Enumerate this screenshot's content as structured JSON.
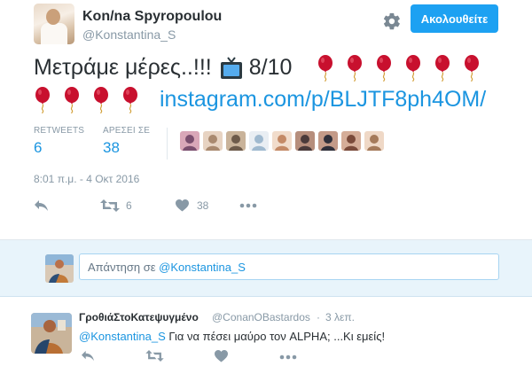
{
  "author": {
    "name": "Kon/na Spyropoulou",
    "handle": "@Konstantina_S",
    "avatar_icon": "profile-photo"
  },
  "follow_button": {
    "label": "Ακολουθείτε"
  },
  "settings_icon": "gear-icon",
  "tweet": {
    "text_main": "Μετράμε μέρες..!!!",
    "counter": "8/10",
    "balloon_count_line1": 6,
    "balloon_count_line2": 4,
    "link": "instagram.com/p/BLJTF8ph4OM/",
    "emoji_icons": [
      "tv-icon",
      "balloon-icon"
    ]
  },
  "stats": {
    "retweets_label": "RETWEETS",
    "retweets_value": "6",
    "likes_label": "ΑΡΕΣΕΙ ΣΕ",
    "likes_value": "38",
    "liker_count": 9
  },
  "timestamp": "8:01 π.μ. - 4 Οκτ 2016",
  "actions": {
    "retweet_count": "6",
    "like_count": "38"
  },
  "reply_composer": {
    "placeholder_prefix": "Απάντηση σε",
    "mention": "@Konstantina_S"
  },
  "reply": {
    "name": "ΓροθιάΣτοΚατεψυγμένο",
    "handle": "@ConanOBastardos",
    "separator": "·",
    "time": "3 λεπ.",
    "mention": "@Konstantina_S",
    "text": "Για να πέσει μαύρο τον ALPHA; ...Κι εμείς!"
  },
  "colors": {
    "accent": "#1da1f2",
    "link": "#1b95e0",
    "muted": "#8899a6",
    "reply_panel_bg": "#e8f4fb",
    "balloon": "#c8102e"
  }
}
